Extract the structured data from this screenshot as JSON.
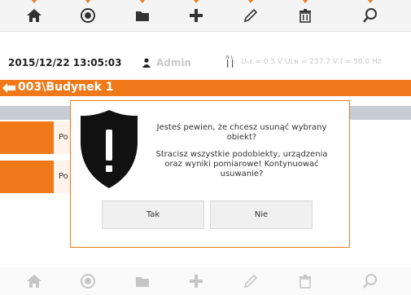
{
  "toolbar": {
    "items": [
      {
        "icon": "home-icon"
      },
      {
        "icon": "record-icon"
      },
      {
        "icon": "folder-icon"
      },
      {
        "icon": "add-icon"
      },
      {
        "icon": "edit-icon"
      },
      {
        "icon": "delete-icon"
      },
      {
        "icon": "search-icon"
      }
    ]
  },
  "status": {
    "datetime": "2015/12/22 13:05:03",
    "user": "Admin",
    "readings": "Uₙᴇ = 0.5 V Uʟɴ = 237.7 V f = 50.0 Hz"
  },
  "path": {
    "text": "003\\Budynek 1"
  },
  "list": {
    "rows": [
      {
        "label": "Po"
      },
      {
        "label": "Po"
      }
    ]
  },
  "dialog": {
    "question": "Jesteś pewien, że chcesz usunąć wybrany obiekt?",
    "warning": "Stracisz wszystkie podobiekty, urządzenia oraz wyniki pomiarowe! Kontynuować usuwanie?",
    "yes_label": "Tak",
    "no_label": "Nie"
  },
  "colors": {
    "accent": "#f07a1a",
    "shield": "#111111"
  }
}
